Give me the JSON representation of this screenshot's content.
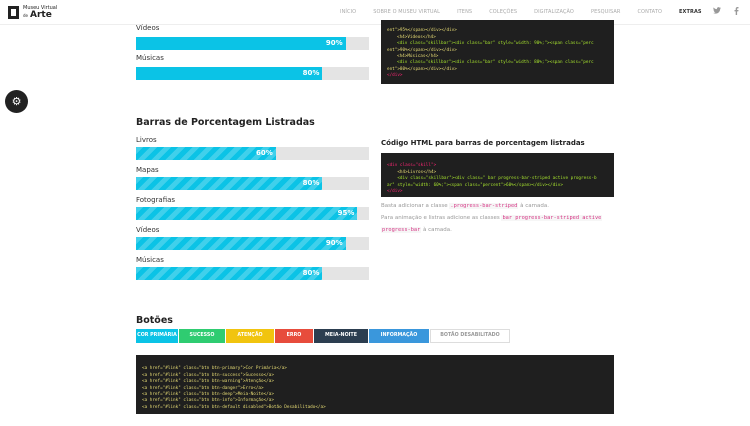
{
  "header": {
    "logo_small": "Museu Virtual",
    "logo_de": "de",
    "logo_big": "Arte",
    "nav": [
      "INÍCIO",
      "SOBRE O MUSEU VIRTUAL",
      "ITENS",
      "COLEÇÕES",
      "DIGITALIZAÇÃO",
      "PESQUISAR",
      "CONTATO",
      "EXTRAS"
    ],
    "active_nav": "EXTRAS",
    "social_icons": [
      "twitter-icon",
      "facebook-icon"
    ]
  },
  "settings_icon": "gears-icon",
  "top_bars": [
    {
      "label": "Vídeos",
      "value": 90,
      "text": "90%"
    },
    {
      "label": "Músicas",
      "value": 80,
      "text": "80%"
    }
  ],
  "top_code_lines": [
    "ent\">95%</span></div></div>",
    "<h4>Vídeos</h4>",
    "<div class=\"skillbar\"><div class=\"bar\" style=\"width: 90%;\"><span class=\"perc",
    "ent\">90%</span></div></div>",
    "<h4>Músicas</h4>",
    "<div class=\"skillbar\"><div class=\"bar\" style=\"width: 80%;\"><span class=\"perc",
    "ent\">80%</span></div></div>",
    "</div>"
  ],
  "striped_section": {
    "title": "Barras de Porcentagem Listradas",
    "bars": [
      {
        "label": "Livros",
        "value": 60,
        "text": "60%"
      },
      {
        "label": "Mapas",
        "value": 80,
        "text": "80%"
      },
      {
        "label": "Fotografias",
        "value": 95,
        "text": "95%"
      },
      {
        "label": "Vídeos",
        "value": 90,
        "text": "90%"
      },
      {
        "label": "Músicas",
        "value": 80,
        "text": "80%"
      }
    ],
    "code_title": "Código HTML para barras de porcentagem listradas",
    "code_lines": [
      "<div class=\"skill\">",
      "    <h4>Livros</h4>",
      "    <div class=\"skillbar\"><div class=\" bar progress-bar-striped active progress-b",
      "ar\" style=\"width: 60%;\"><span class=\"percent\">60%</span></div></div>",
      "</div>"
    ],
    "note1_prefix": "Basta adicionar a classe",
    "note1_code": ".progress-bar-striped",
    "note1_suffix": "à camada.",
    "note2_prefix": "Para animação e listras adicione as classes",
    "note2_code1": "bar progress-bar-striped active",
    "note2_code2": "progress-bar",
    "note2_suffix": "à camada."
  },
  "buttons_section": {
    "title": "Botões",
    "buttons": [
      {
        "label": "COR PRIMÁRIA",
        "color": "#0bc3e6"
      },
      {
        "label": "SUCESSO",
        "color": "#2fcc71"
      },
      {
        "label": "ATENÇÃO",
        "color": "#f1c40f"
      },
      {
        "label": "ERRO",
        "color": "#e74c3c"
      },
      {
        "label": "MEIA-NOITE",
        "color": "#2c3e50"
      },
      {
        "label": "INFORMAÇÃO",
        "color": "#3a97dc"
      },
      {
        "label": "BOTÃO DESABILITADO",
        "color": "#ffffff"
      }
    ],
    "code_lines": [
      "<a href=\"#link\" class=\"btn btn-primary\">Cor Primária</a>",
      "<a href=\"#link\" class=\"btn btn-success\">Sucesso</a>",
      "<a href=\"#link\" class=\"btn btn-warning\">Atenção</a>",
      "<a href=\"#link\" class=\"btn btn-danger\">Erro</a>",
      "<a href=\"#link\" class=\"btn btn-deep\">Meia-Noite</a>",
      "<a href=\"#link\" class=\"btn btn-info\">Informação</a>",
      "<a href=\"#link\" class=\"btn btn-default disabled\">Botão Desabilitado</a>"
    ]
  }
}
